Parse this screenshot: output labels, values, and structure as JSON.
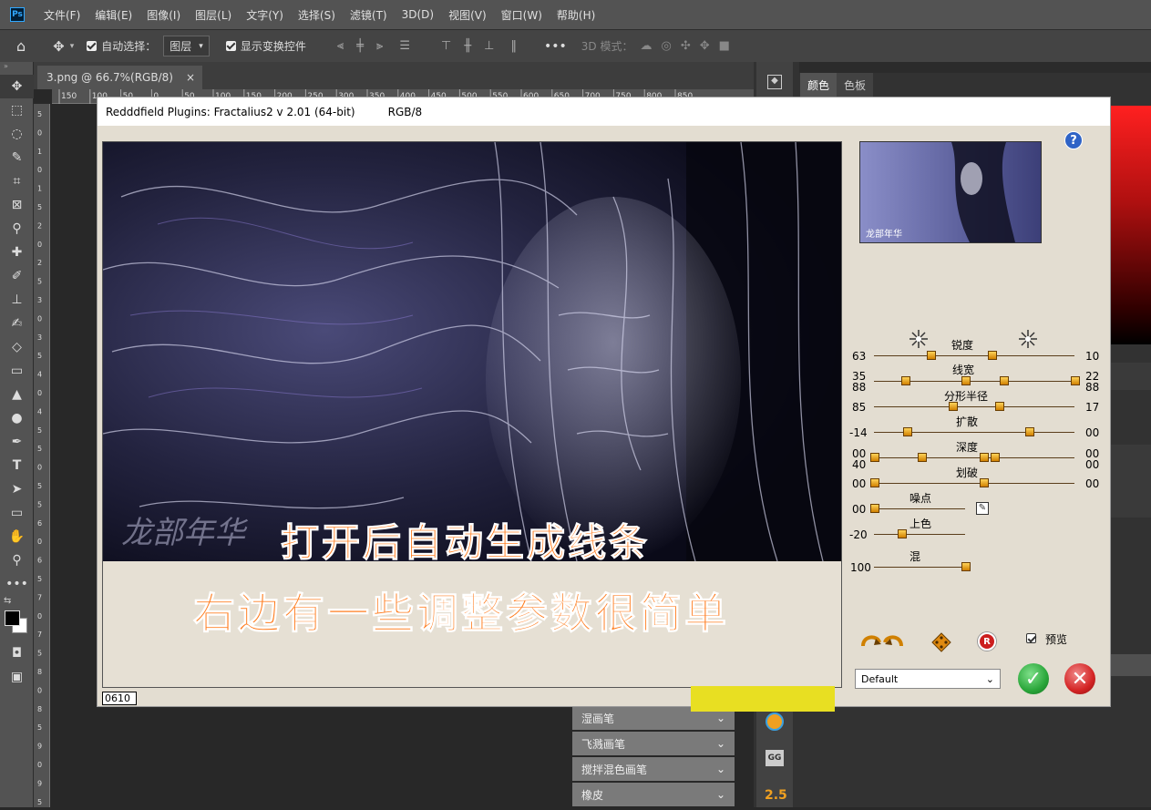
{
  "app": {
    "logo": "Ps"
  },
  "menu": [
    "文件(F)",
    "编辑(E)",
    "图像(I)",
    "图层(L)",
    "文字(Y)",
    "选择(S)",
    "滤镜(T)",
    "3D(D)",
    "视图(V)",
    "窗口(W)",
    "帮助(H)"
  ],
  "options": {
    "auto_select_label": "自动选择：",
    "layer_select": "图层",
    "show_transform": "显示变换控件",
    "mode3d": "3D 模式："
  },
  "document": {
    "tab_title": "3.png @ 66.7%(RGB/8)",
    "close": "×"
  },
  "ruler": {
    "h_ticks": [
      "150",
      "100",
      "50",
      "0",
      "50",
      "100",
      "150",
      "200",
      "250",
      "300",
      "350",
      "400",
      "450",
      "500",
      "550",
      "600",
      "650",
      "700",
      "750",
      "800",
      "850"
    ],
    "v_ticks": [
      "5",
      "0",
      "1",
      "0",
      "1",
      "5",
      "2",
      "0",
      "2",
      "5",
      "3",
      "0",
      "3",
      "5",
      "4",
      "0",
      "4",
      "5",
      "5",
      "0",
      "5",
      "5",
      "6",
      "0",
      "6",
      "5",
      "7",
      "0",
      "7",
      "5",
      "8",
      "0",
      "8",
      "5",
      "9",
      "0",
      "9",
      "5"
    ]
  },
  "panels": {
    "tabs": [
      "颜色",
      "色板"
    ],
    "brushes": [
      "湿画笔",
      "飞溅画笔",
      "搅拌混色画笔",
      "橡皮"
    ],
    "gg": "GG",
    "value": "2.5"
  },
  "dialog": {
    "title": "Redddfield Plugins: Fractalius2 v 2.01 (64-bit)",
    "mode": "RGB/8",
    "help": "?",
    "thumb_text": "龙部年华",
    "art_text": "龙部年华",
    "status": "0610",
    "preview_label": "预览",
    "preset": "Default",
    "ok": "✓",
    "cancel": "✕",
    "reset": "R",
    "sliders": {
      "sharpness": {
        "label": "锐度",
        "left": "63",
        "right": "10"
      },
      "linewidth": {
        "label": "线宽",
        "left_top": "35",
        "left_bottom": "88",
        "right_top": "22",
        "right_bottom": "88"
      },
      "fractal_radius": {
        "label": "分形半径",
        "left": "85",
        "right": "17"
      },
      "diffuse": {
        "label": "扩散",
        "left": "-14",
        "right": "00"
      },
      "depth": {
        "label": "深度",
        "left_top": "00",
        "left_bottom": "40",
        "right_top": "00",
        "right_bottom": "00"
      },
      "break": {
        "label": "划破",
        "left": "00",
        "right": "00"
      },
      "noise": {
        "label": "噪点",
        "left": "00"
      },
      "colorize": {
        "label": "上色",
        "left": "-20"
      },
      "blend": {
        "label": "混",
        "left": "100"
      }
    }
  },
  "overlay": {
    "line1": "打开后自动生成线条",
    "line2": "右边有一些调整参数很简单"
  },
  "colors": {
    "accent_orange": "#ff7a1a",
    "ok_green": "#2aa63a",
    "cancel_red": "#d42424",
    "knob": "#f0a020"
  }
}
